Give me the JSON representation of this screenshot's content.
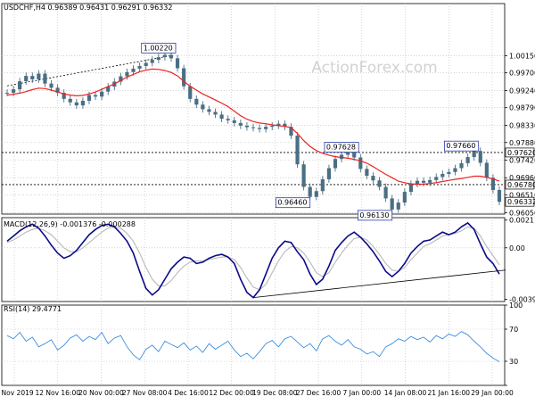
{
  "chart_data": {
    "type": "candlestick",
    "watermark": "ActionForex.com",
    "x_ticks": [
      "5 Nov 2019",
      "12 Nov 16:00",
      "20 Nov 00:00",
      "27 Nov 08:00",
      "4 Dec 16:00",
      "12 Dec 00:00",
      "19 Dec 08:00",
      "27 Dec 16:00",
      "7 Jan 00:00",
      "14 Jan 08:00",
      "21 Jan 16:00",
      "29 Jan 00:00"
    ],
    "price_panel": {
      "header": "USDCHF,H4  0.96389 0.96431 0.96291 0.96332",
      "ylim": [
        0.9601,
        1.0151
      ],
      "y_ticks": [
        1.0015,
        0.997,
        0.9924,
        0.9879,
        0.9833,
        0.9788,
        0.9742,
        0.9696,
        0.9651,
        0.9605
      ],
      "y_tick_labels": [
        "1.00150",
        "0.99700",
        "0.99240",
        "0.98790",
        "0.98330",
        "0.97880",
        "0.97420",
        "0.96960",
        "0.96510",
        "0.96050"
      ],
      "price_series": [
        0.9918,
        0.9927,
        0.9948,
        0.9962,
        0.9953,
        0.9968,
        0.9942,
        0.9931,
        0.9918,
        0.9902,
        0.9893,
        0.9885,
        0.9897,
        0.9912,
        0.9908,
        0.9921,
        0.9934,
        0.9947,
        0.9961,
        0.9972,
        0.9981,
        0.9988,
        0.9996,
        1.0004,
        1.0011,
        1.0017,
        1.0008,
        0.9982,
        0.9935,
        0.9902,
        0.9887,
        0.9875,
        0.9868,
        0.9861,
        0.985,
        0.9846,
        0.9839,
        0.9832,
        0.9828,
        0.9826,
        0.9823,
        0.9829,
        0.9832,
        0.9837,
        0.9829,
        0.9806,
        0.9731,
        0.9672,
        0.9646,
        0.9661,
        0.9692,
        0.9721,
        0.9745,
        0.9756,
        0.9763,
        0.9749,
        0.9719,
        0.9701,
        0.9689,
        0.9672,
        0.9642,
        0.9613,
        0.9631,
        0.9659,
        0.968,
        0.9688,
        0.9683,
        0.969,
        0.9698,
        0.9706,
        0.9711,
        0.9721,
        0.9734,
        0.975,
        0.9766,
        0.9735,
        0.9696,
        0.9664,
        0.9633
      ],
      "ma_series": [
        0.9912,
        0.9914,
        0.9917,
        0.9921,
        0.9926,
        0.993,
        0.9929,
        0.9925,
        0.992,
        0.9915,
        0.9912,
        0.991,
        0.9911,
        0.9915,
        0.992,
        0.9927,
        0.9934,
        0.9941,
        0.995,
        0.9959,
        0.9966,
        0.9973,
        0.9977,
        0.998,
        0.9979,
        0.9976,
        0.9971,
        0.9962,
        0.9948,
        0.9935,
        0.9925,
        0.9915,
        0.9907,
        0.9899,
        0.9891,
        0.9882,
        0.987,
        0.9858,
        0.9849,
        0.9843,
        0.9839,
        0.9837,
        0.9834,
        0.9832,
        0.983,
        0.9827,
        0.9812,
        0.9793,
        0.9778,
        0.9767,
        0.976,
        0.9755,
        0.9751,
        0.9749,
        0.9747,
        0.9744,
        0.974,
        0.9734,
        0.9725,
        0.9715,
        0.9705,
        0.9696,
        0.9687,
        0.9683,
        0.968,
        0.9679,
        0.9679,
        0.9681,
        0.9683,
        0.9686,
        0.9689,
        0.9692,
        0.9694,
        0.9697,
        0.97,
        0.97,
        0.9697,
        0.9693,
        0.9687
      ],
      "ma_color": "#ee2222",
      "candle_color": "#4a6f84",
      "trendline": {
        "from": {
          "index": 0,
          "price": 0.9936
        },
        "to": {
          "index": 26,
          "price": 1.0015
        }
      },
      "hlines": [
        {
          "value": 0.9762,
          "label": "0.97620"
        },
        {
          "value": 0.9678,
          "label": "0.96780"
        }
      ],
      "annotations": [
        {
          "label": "1.00220",
          "index": 24,
          "price": 1.0022
        },
        {
          "label": "0.97628",
          "index": 53,
          "price": 0.97628
        },
        {
          "label": "0.97660",
          "index": 72,
          "price": 0.9766
        },
        {
          "label": "0.96460",
          "index": 48,
          "price": 0.9646
        },
        {
          "label": "0.96130",
          "index": 61,
          "price": 0.9613
        }
      ],
      "last_price_label": "0.96332",
      "last_price": 0.96332
    },
    "macd_panel": {
      "header": "MACD(12,26,9) -0.001376 -0.000288",
      "ylim": [
        -0.0041,
        0.0023
      ],
      "y_ticks": [
        0.002113,
        0.0,
        -0.003922
      ],
      "y_tick_labels": [
        "0.002113",
        "0.00",
        "-0.003922"
      ],
      "macd_series": [
        0.0005,
        0.0009,
        0.0013,
        0.0016,
        0.0018,
        0.0015,
        0.0009,
        0.0002,
        -0.0004,
        -0.0008,
        -0.0006,
        -0.0002,
        0.0004,
        0.001,
        0.0014,
        0.0017,
        0.0018,
        0.0016,
        0.0011,
        0.0005,
        -0.0004,
        -0.0018,
        -0.0031,
        -0.0036,
        -0.0032,
        -0.0024,
        -0.0016,
        -0.0011,
        -0.0007,
        -0.0008,
        -0.0012,
        -0.0011,
        -0.0008,
        -0.0006,
        -0.0005,
        -0.0007,
        -0.0012,
        -0.0024,
        -0.0034,
        -0.0038,
        -0.0032,
        -0.002,
        -0.0008,
        0.0,
        0.0005,
        0.0004,
        -0.0003,
        -0.0009,
        -0.002,
        -0.0028,
        -0.0024,
        -0.0014,
        -0.0002,
        0.0004,
        0.0009,
        0.0012,
        0.0008,
        0.0003,
        -0.0003,
        -0.001,
        -0.0018,
        -0.0022,
        -0.0018,
        -0.0012,
        -0.0004,
        0.0001,
        0.0005,
        0.0006,
        0.0009,
        0.0012,
        0.001,
        0.0012,
        0.0016,
        0.0019,
        0.0014,
        0.0003,
        -0.0007,
        -0.0012,
        -0.002
      ],
      "signal_series": [
        0.0004,
        0.0006,
        0.0009,
        0.0012,
        0.0014,
        0.0015,
        0.0013,
        0.001,
        0.0005,
        0.0,
        -0.0003,
        -0.0003,
        0.0,
        0.0004,
        0.0008,
        0.0012,
        0.0015,
        0.0016,
        0.0015,
        0.0011,
        0.0005,
        -0.0004,
        -0.0015,
        -0.0024,
        -0.0029,
        -0.0029,
        -0.0025,
        -0.0019,
        -0.0014,
        -0.0011,
        -0.001,
        -0.001,
        -0.0009,
        -0.0008,
        -0.0007,
        -0.0007,
        -0.0009,
        -0.0015,
        -0.0023,
        -0.003,
        -0.0032,
        -0.0028,
        -0.0019,
        -0.001,
        -0.0003,
        0.0001,
        0.0,
        -0.0004,
        -0.0011,
        -0.0019,
        -0.0022,
        -0.0019,
        -0.0011,
        -0.0004,
        0.0002,
        0.0007,
        0.0008,
        0.0006,
        0.0001,
        -0.0005,
        -0.0012,
        -0.0017,
        -0.0018,
        -0.0015,
        -0.0009,
        -0.0004,
        0.0001,
        0.0003,
        0.0006,
        0.0009,
        0.001,
        0.0011,
        0.0013,
        0.0016,
        0.0015,
        0.0009,
        0.0001,
        -0.0006,
        -0.0013
      ],
      "macd_color": "#0b0b8a",
      "signal_color": "#b8b8b8",
      "trendline": {
        "from": {
          "index": 39,
          "macd": -0.0038
        },
        "to": {
          "index": 79,
          "macd": -0.0017
        }
      }
    },
    "rsi_panel": {
      "header": "RSI(14) 29.4771",
      "ylim": [
        0,
        100
      ],
      "y_ticks": [
        100,
        70,
        30,
        0
      ],
      "y_tick_labels": [
        "100",
        "70",
        "30",
        "0"
      ],
      "levels": [
        70,
        30
      ],
      "rsi_series": [
        62,
        58,
        66,
        55,
        60,
        48,
        52,
        57,
        44,
        50,
        59,
        63,
        55,
        61,
        57,
        66,
        52,
        59,
        62,
        48,
        38,
        32,
        45,
        50,
        42,
        55,
        51,
        47,
        53,
        44,
        49,
        41,
        52,
        45,
        50,
        55,
        44,
        36,
        40,
        33,
        42,
        52,
        56,
        48,
        58,
        61,
        54,
        47,
        52,
        43,
        58,
        62,
        55,
        50,
        57,
        48,
        45,
        39,
        42,
        36,
        48,
        52,
        58,
        55,
        61,
        57,
        60,
        54,
        62,
        58,
        64,
        61,
        67,
        63,
        55,
        48,
        40,
        34,
        29.4771
      ],
      "line_color": "#3e8ee0"
    }
  }
}
